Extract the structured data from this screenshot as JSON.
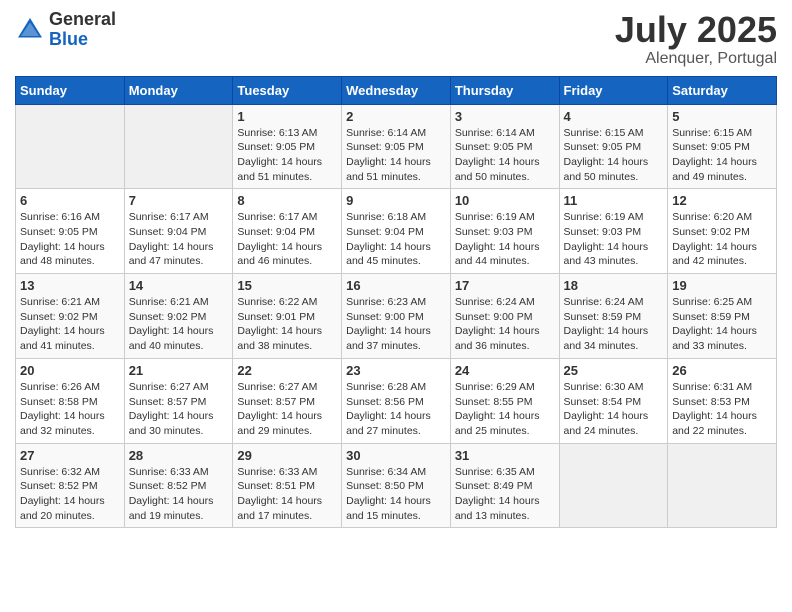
{
  "logo": {
    "general": "General",
    "blue": "Blue"
  },
  "title": {
    "month_year": "July 2025",
    "location": "Alenquer, Portugal"
  },
  "days_of_week": [
    "Sunday",
    "Monday",
    "Tuesday",
    "Wednesday",
    "Thursday",
    "Friday",
    "Saturday"
  ],
  "weeks": [
    [
      {
        "day": "",
        "info": ""
      },
      {
        "day": "",
        "info": ""
      },
      {
        "day": "1",
        "info": "Sunrise: 6:13 AM\nSunset: 9:05 PM\nDaylight: 14 hours and 51 minutes."
      },
      {
        "day": "2",
        "info": "Sunrise: 6:14 AM\nSunset: 9:05 PM\nDaylight: 14 hours and 51 minutes."
      },
      {
        "day": "3",
        "info": "Sunrise: 6:14 AM\nSunset: 9:05 PM\nDaylight: 14 hours and 50 minutes."
      },
      {
        "day": "4",
        "info": "Sunrise: 6:15 AM\nSunset: 9:05 PM\nDaylight: 14 hours and 50 minutes."
      },
      {
        "day": "5",
        "info": "Sunrise: 6:15 AM\nSunset: 9:05 PM\nDaylight: 14 hours and 49 minutes."
      }
    ],
    [
      {
        "day": "6",
        "info": "Sunrise: 6:16 AM\nSunset: 9:05 PM\nDaylight: 14 hours and 48 minutes."
      },
      {
        "day": "7",
        "info": "Sunrise: 6:17 AM\nSunset: 9:04 PM\nDaylight: 14 hours and 47 minutes."
      },
      {
        "day": "8",
        "info": "Sunrise: 6:17 AM\nSunset: 9:04 PM\nDaylight: 14 hours and 46 minutes."
      },
      {
        "day": "9",
        "info": "Sunrise: 6:18 AM\nSunset: 9:04 PM\nDaylight: 14 hours and 45 minutes."
      },
      {
        "day": "10",
        "info": "Sunrise: 6:19 AM\nSunset: 9:03 PM\nDaylight: 14 hours and 44 minutes."
      },
      {
        "day": "11",
        "info": "Sunrise: 6:19 AM\nSunset: 9:03 PM\nDaylight: 14 hours and 43 minutes."
      },
      {
        "day": "12",
        "info": "Sunrise: 6:20 AM\nSunset: 9:02 PM\nDaylight: 14 hours and 42 minutes."
      }
    ],
    [
      {
        "day": "13",
        "info": "Sunrise: 6:21 AM\nSunset: 9:02 PM\nDaylight: 14 hours and 41 minutes."
      },
      {
        "day": "14",
        "info": "Sunrise: 6:21 AM\nSunset: 9:02 PM\nDaylight: 14 hours and 40 minutes."
      },
      {
        "day": "15",
        "info": "Sunrise: 6:22 AM\nSunset: 9:01 PM\nDaylight: 14 hours and 38 minutes."
      },
      {
        "day": "16",
        "info": "Sunrise: 6:23 AM\nSunset: 9:00 PM\nDaylight: 14 hours and 37 minutes."
      },
      {
        "day": "17",
        "info": "Sunrise: 6:24 AM\nSunset: 9:00 PM\nDaylight: 14 hours and 36 minutes."
      },
      {
        "day": "18",
        "info": "Sunrise: 6:24 AM\nSunset: 8:59 PM\nDaylight: 14 hours and 34 minutes."
      },
      {
        "day": "19",
        "info": "Sunrise: 6:25 AM\nSunset: 8:59 PM\nDaylight: 14 hours and 33 minutes."
      }
    ],
    [
      {
        "day": "20",
        "info": "Sunrise: 6:26 AM\nSunset: 8:58 PM\nDaylight: 14 hours and 32 minutes."
      },
      {
        "day": "21",
        "info": "Sunrise: 6:27 AM\nSunset: 8:57 PM\nDaylight: 14 hours and 30 minutes."
      },
      {
        "day": "22",
        "info": "Sunrise: 6:27 AM\nSunset: 8:57 PM\nDaylight: 14 hours and 29 minutes."
      },
      {
        "day": "23",
        "info": "Sunrise: 6:28 AM\nSunset: 8:56 PM\nDaylight: 14 hours and 27 minutes."
      },
      {
        "day": "24",
        "info": "Sunrise: 6:29 AM\nSunset: 8:55 PM\nDaylight: 14 hours and 25 minutes."
      },
      {
        "day": "25",
        "info": "Sunrise: 6:30 AM\nSunset: 8:54 PM\nDaylight: 14 hours and 24 minutes."
      },
      {
        "day": "26",
        "info": "Sunrise: 6:31 AM\nSunset: 8:53 PM\nDaylight: 14 hours and 22 minutes."
      }
    ],
    [
      {
        "day": "27",
        "info": "Sunrise: 6:32 AM\nSunset: 8:52 PM\nDaylight: 14 hours and 20 minutes."
      },
      {
        "day": "28",
        "info": "Sunrise: 6:33 AM\nSunset: 8:52 PM\nDaylight: 14 hours and 19 minutes."
      },
      {
        "day": "29",
        "info": "Sunrise: 6:33 AM\nSunset: 8:51 PM\nDaylight: 14 hours and 17 minutes."
      },
      {
        "day": "30",
        "info": "Sunrise: 6:34 AM\nSunset: 8:50 PM\nDaylight: 14 hours and 15 minutes."
      },
      {
        "day": "31",
        "info": "Sunrise: 6:35 AM\nSunset: 8:49 PM\nDaylight: 14 hours and 13 minutes."
      },
      {
        "day": "",
        "info": ""
      },
      {
        "day": "",
        "info": ""
      }
    ]
  ]
}
